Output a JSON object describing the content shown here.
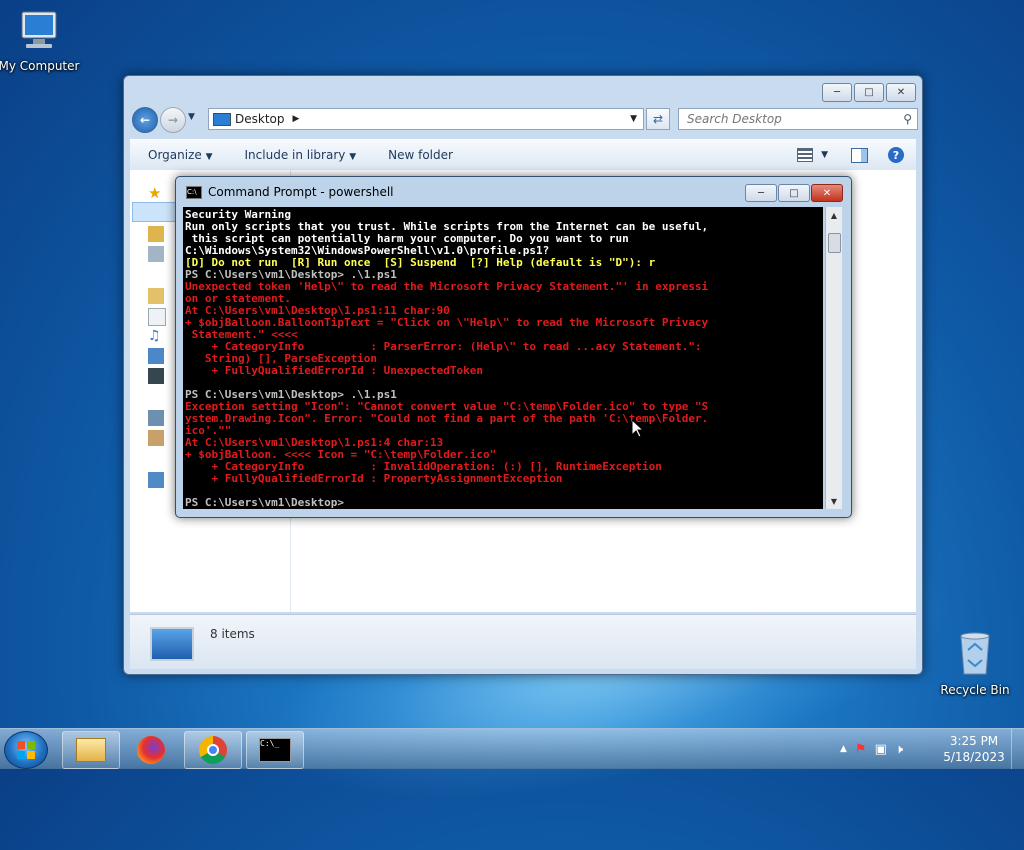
{
  "desktop": {
    "icons": [
      {
        "label": "My Computer",
        "icon": "computer-icon"
      },
      {
        "label": "Recycle Bin",
        "icon": "recycle-bin-icon"
      }
    ]
  },
  "explorer": {
    "address": "Desktop",
    "search_placeholder": "Search Desktop",
    "toolbar": {
      "organize": "Organize",
      "include_in_library": "Include in library",
      "new_folder": "New folder"
    },
    "details": {
      "item_count": "8 items"
    }
  },
  "cmd": {
    "title": "Command Prompt - powershell",
    "lines": [
      {
        "text": "Security Warning",
        "color": "w"
      },
      {
        "text": "Run only scripts that you trust. While scripts from the Internet can be useful,",
        "color": "w"
      },
      {
        "text": " this script can potentially harm your computer. Do you want to run",
        "color": "w"
      },
      {
        "text": "C:\\Windows\\System32\\WindowsPowerShell\\v1.0\\profile.ps1?",
        "color": "w"
      },
      {
        "text": "[D] Do not run  [R] Run once  [S] Suspend  [?] Help (default is \"D\"): r",
        "color": "y"
      },
      {
        "text": "PS C:\\Users\\vm1\\Desktop> .\\1.ps1",
        "color": "g"
      },
      {
        "text": "Unexpected token 'Help\\\" to read the Microsoft Privacy Statement.\"' in expressi",
        "color": "r"
      },
      {
        "text": "on or statement.",
        "color": "r"
      },
      {
        "text": "At C:\\Users\\vm1\\Desktop\\1.ps1:11 char:90",
        "color": "r"
      },
      {
        "text": "+ $objBalloon.BalloonTipText = \"Click on \\\"Help\\\" to read the Microsoft Privacy",
        "color": "r"
      },
      {
        "text": " Statement.\" <<<<",
        "color": "r"
      },
      {
        "text": "    + CategoryInfo          : ParserError: (Help\\\" to read ...acy Statement.\":",
        "color": "r"
      },
      {
        "text": "   String) [], ParseException",
        "color": "r"
      },
      {
        "text": "    + FullyQualifiedErrorId : UnexpectedToken",
        "color": "r"
      },
      {
        "text": "",
        "color": "g"
      },
      {
        "text": "PS C:\\Users\\vm1\\Desktop> .\\1.ps1",
        "color": "g"
      },
      {
        "text": "Exception setting \"Icon\": \"Cannot convert value \"C:\\temp\\Folder.ico\" to type \"S",
        "color": "r"
      },
      {
        "text": "ystem.Drawing.Icon\". Error: \"Could not find a part of the path 'C:\\temp\\Folder.",
        "color": "r"
      },
      {
        "text": "ico'.\"\"",
        "color": "r"
      },
      {
        "text": "At C:\\Users\\vm1\\Desktop\\1.ps1:4 char:13",
        "color": "r"
      },
      {
        "text": "+ $objBalloon. <<<< Icon = \"C:\\temp\\Folder.ico\"",
        "color": "r"
      },
      {
        "text": "    + CategoryInfo          : InvalidOperation: (:) [], RuntimeException",
        "color": "r"
      },
      {
        "text": "    + FullyQualifiedErrorId : PropertyAssignmentException",
        "color": "r"
      },
      {
        "text": "",
        "color": "g"
      },
      {
        "text": "PS C:\\Users\\vm1\\Desktop>",
        "color": "g"
      }
    ]
  },
  "taskbar": {
    "apps": [
      "windows-explorer-icon",
      "firefox-icon",
      "chrome-icon",
      "command-prompt-icon"
    ],
    "time": "3:25 PM",
    "date": "5/18/2023"
  }
}
